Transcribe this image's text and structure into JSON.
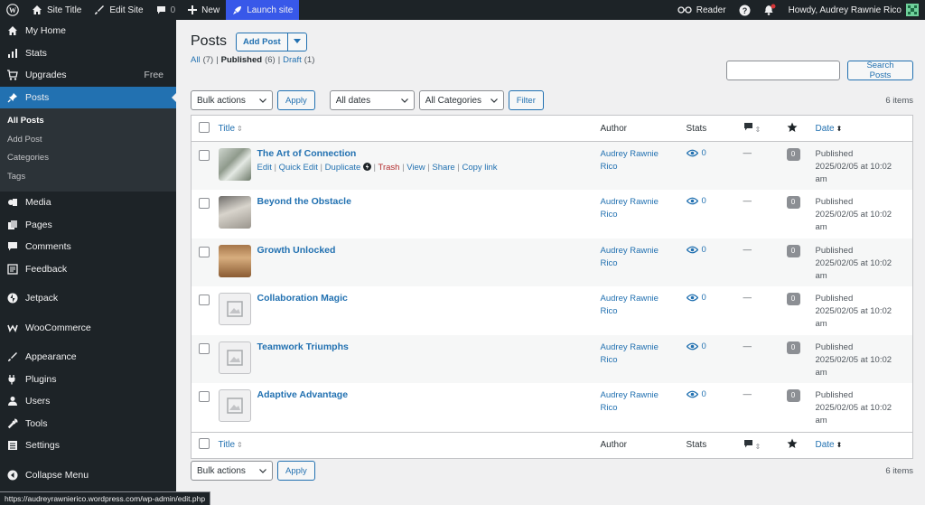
{
  "adminbar": {
    "site_title": "Site Title",
    "edit_site": "Edit Site",
    "comments_count": "0",
    "new": "New",
    "launch": "Launch site",
    "reader": "Reader",
    "howdy": "Howdy, Audrey Rawnie Rico"
  },
  "sidebar": {
    "my_home": "My Home",
    "stats": "Stats",
    "upgrades": "Upgrades",
    "upgrades_badge": "Free",
    "posts": "Posts",
    "sub": [
      "All Posts",
      "Add Post",
      "Categories",
      "Tags"
    ],
    "media": "Media",
    "pages": "Pages",
    "comments": "Comments",
    "feedback": "Feedback",
    "jetpack": "Jetpack",
    "woocommerce": "WooCommerce",
    "appearance": "Appearance",
    "plugins": "Plugins",
    "users": "Users",
    "tools": "Tools",
    "settings": "Settings",
    "collapse": "Collapse Menu"
  },
  "header": {
    "title": "Posts",
    "add_post": "Add Post"
  },
  "views": {
    "all": "All",
    "all_count": "(7)",
    "published": "Published",
    "published_count": "(6)",
    "draft": "Draft",
    "draft_count": "(1)"
  },
  "search": {
    "button": "Search Posts"
  },
  "filters": {
    "bulk_actions": "Bulk actions",
    "apply": "Apply",
    "dates": "All dates",
    "categories": "All Categories",
    "filter": "Filter",
    "items_count": "6 items"
  },
  "table": {
    "headers": {
      "title": "Title",
      "author": "Author",
      "stats": "Stats",
      "date": "Date"
    },
    "row_actions": {
      "edit": "Edit",
      "quick_edit": "Quick Edit",
      "duplicate": "Duplicate",
      "trash": "Trash",
      "view": "View",
      "share": "Share",
      "copy_link": "Copy link"
    },
    "rows": [
      {
        "title": "The Art of Connection",
        "author_line1": "Audrey Rawnie",
        "author_line2": "Rico",
        "views": "0",
        "comments": "—",
        "likes": "0",
        "status": "Published",
        "date": "2025/02/05 at 10:02",
        "time_suffix": "am",
        "thumb": "image"
      },
      {
        "title": "Beyond the Obstacle",
        "author_line1": "Audrey Rawnie",
        "author_line2": "Rico",
        "views": "0",
        "comments": "—",
        "likes": "0",
        "status": "Published",
        "date": "2025/02/05 at 10:02",
        "time_suffix": "am",
        "thumb": "image"
      },
      {
        "title": "Growth Unlocked",
        "author_line1": "Audrey Rawnie",
        "author_line2": "Rico",
        "views": "0",
        "comments": "—",
        "likes": "0",
        "status": "Published",
        "date": "2025/02/05 at 10:02",
        "time_suffix": "am",
        "thumb": "image"
      },
      {
        "title": "Collaboration Magic",
        "author_line1": "Audrey Rawnie",
        "author_line2": "Rico",
        "views": "0",
        "comments": "—",
        "likes": "0",
        "status": "Published",
        "date": "2025/02/05 at 10:02",
        "time_suffix": "am",
        "thumb": "placeholder"
      },
      {
        "title": "Teamwork Triumphs",
        "author_line1": "Audrey Rawnie",
        "author_line2": "Rico",
        "views": "0",
        "comments": "—",
        "likes": "0",
        "status": "Published",
        "date": "2025/02/05 at 10:02",
        "time_suffix": "am",
        "thumb": "placeholder"
      },
      {
        "title": "Adaptive Advantage",
        "author_line1": "Audrey Rawnie",
        "author_line2": "Rico",
        "views": "0",
        "comments": "—",
        "likes": "0",
        "status": "Published",
        "date": "2025/02/05 at 10:02",
        "time_suffix": "am",
        "thumb": "placeholder"
      }
    ]
  },
  "statusbar": {
    "url": "https://audreyrawnierico.wordpress.com/wp-admin/edit.php"
  },
  "colors": {
    "accent": "#2271b1",
    "launch": "#3858e9",
    "adminbar": "#1d2327",
    "trash": "#b32d2e"
  }
}
